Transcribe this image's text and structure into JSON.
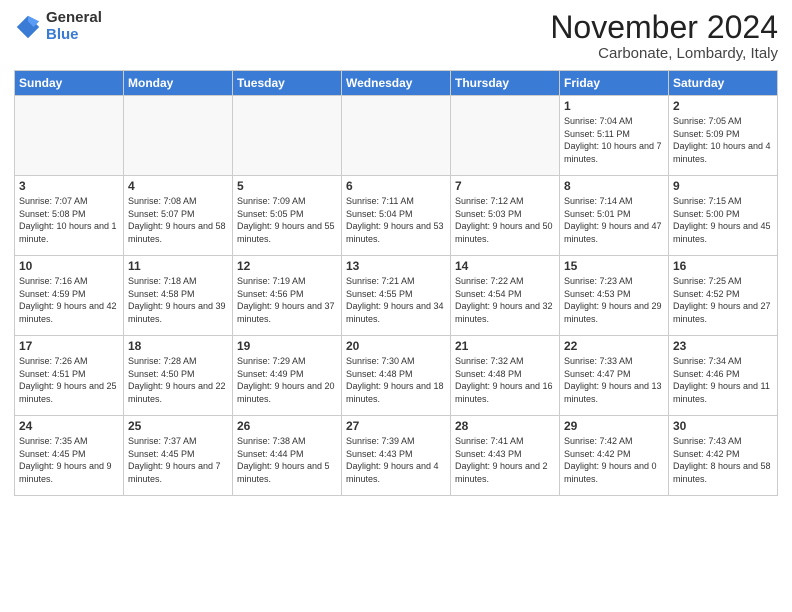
{
  "logo": {
    "general": "General",
    "blue": "Blue"
  },
  "header": {
    "month": "November 2024",
    "location": "Carbonate, Lombardy, Italy"
  },
  "weekdays": [
    "Sunday",
    "Monday",
    "Tuesday",
    "Wednesday",
    "Thursday",
    "Friday",
    "Saturday"
  ],
  "weeks": [
    [
      {
        "day": "",
        "info": ""
      },
      {
        "day": "",
        "info": ""
      },
      {
        "day": "",
        "info": ""
      },
      {
        "day": "",
        "info": ""
      },
      {
        "day": "",
        "info": ""
      },
      {
        "day": "1",
        "info": "Sunrise: 7:04 AM\nSunset: 5:11 PM\nDaylight: 10 hours and 7 minutes."
      },
      {
        "day": "2",
        "info": "Sunrise: 7:05 AM\nSunset: 5:09 PM\nDaylight: 10 hours and 4 minutes."
      }
    ],
    [
      {
        "day": "3",
        "info": "Sunrise: 7:07 AM\nSunset: 5:08 PM\nDaylight: 10 hours and 1 minute."
      },
      {
        "day": "4",
        "info": "Sunrise: 7:08 AM\nSunset: 5:07 PM\nDaylight: 9 hours and 58 minutes."
      },
      {
        "day": "5",
        "info": "Sunrise: 7:09 AM\nSunset: 5:05 PM\nDaylight: 9 hours and 55 minutes."
      },
      {
        "day": "6",
        "info": "Sunrise: 7:11 AM\nSunset: 5:04 PM\nDaylight: 9 hours and 53 minutes."
      },
      {
        "day": "7",
        "info": "Sunrise: 7:12 AM\nSunset: 5:03 PM\nDaylight: 9 hours and 50 minutes."
      },
      {
        "day": "8",
        "info": "Sunrise: 7:14 AM\nSunset: 5:01 PM\nDaylight: 9 hours and 47 minutes."
      },
      {
        "day": "9",
        "info": "Sunrise: 7:15 AM\nSunset: 5:00 PM\nDaylight: 9 hours and 45 minutes."
      }
    ],
    [
      {
        "day": "10",
        "info": "Sunrise: 7:16 AM\nSunset: 4:59 PM\nDaylight: 9 hours and 42 minutes."
      },
      {
        "day": "11",
        "info": "Sunrise: 7:18 AM\nSunset: 4:58 PM\nDaylight: 9 hours and 39 minutes."
      },
      {
        "day": "12",
        "info": "Sunrise: 7:19 AM\nSunset: 4:56 PM\nDaylight: 9 hours and 37 minutes."
      },
      {
        "day": "13",
        "info": "Sunrise: 7:21 AM\nSunset: 4:55 PM\nDaylight: 9 hours and 34 minutes."
      },
      {
        "day": "14",
        "info": "Sunrise: 7:22 AM\nSunset: 4:54 PM\nDaylight: 9 hours and 32 minutes."
      },
      {
        "day": "15",
        "info": "Sunrise: 7:23 AM\nSunset: 4:53 PM\nDaylight: 9 hours and 29 minutes."
      },
      {
        "day": "16",
        "info": "Sunrise: 7:25 AM\nSunset: 4:52 PM\nDaylight: 9 hours and 27 minutes."
      }
    ],
    [
      {
        "day": "17",
        "info": "Sunrise: 7:26 AM\nSunset: 4:51 PM\nDaylight: 9 hours and 25 minutes."
      },
      {
        "day": "18",
        "info": "Sunrise: 7:28 AM\nSunset: 4:50 PM\nDaylight: 9 hours and 22 minutes."
      },
      {
        "day": "19",
        "info": "Sunrise: 7:29 AM\nSunset: 4:49 PM\nDaylight: 9 hours and 20 minutes."
      },
      {
        "day": "20",
        "info": "Sunrise: 7:30 AM\nSunset: 4:48 PM\nDaylight: 9 hours and 18 minutes."
      },
      {
        "day": "21",
        "info": "Sunrise: 7:32 AM\nSunset: 4:48 PM\nDaylight: 9 hours and 16 minutes."
      },
      {
        "day": "22",
        "info": "Sunrise: 7:33 AM\nSunset: 4:47 PM\nDaylight: 9 hours and 13 minutes."
      },
      {
        "day": "23",
        "info": "Sunrise: 7:34 AM\nSunset: 4:46 PM\nDaylight: 9 hours and 11 minutes."
      }
    ],
    [
      {
        "day": "24",
        "info": "Sunrise: 7:35 AM\nSunset: 4:45 PM\nDaylight: 9 hours and 9 minutes."
      },
      {
        "day": "25",
        "info": "Sunrise: 7:37 AM\nSunset: 4:45 PM\nDaylight: 9 hours and 7 minutes."
      },
      {
        "day": "26",
        "info": "Sunrise: 7:38 AM\nSunset: 4:44 PM\nDaylight: 9 hours and 5 minutes."
      },
      {
        "day": "27",
        "info": "Sunrise: 7:39 AM\nSunset: 4:43 PM\nDaylight: 9 hours and 4 minutes."
      },
      {
        "day": "28",
        "info": "Sunrise: 7:41 AM\nSunset: 4:43 PM\nDaylight: 9 hours and 2 minutes."
      },
      {
        "day": "29",
        "info": "Sunrise: 7:42 AM\nSunset: 4:42 PM\nDaylight: 9 hours and 0 minutes."
      },
      {
        "day": "30",
        "info": "Sunrise: 7:43 AM\nSunset: 4:42 PM\nDaylight: 8 hours and 58 minutes."
      }
    ]
  ]
}
